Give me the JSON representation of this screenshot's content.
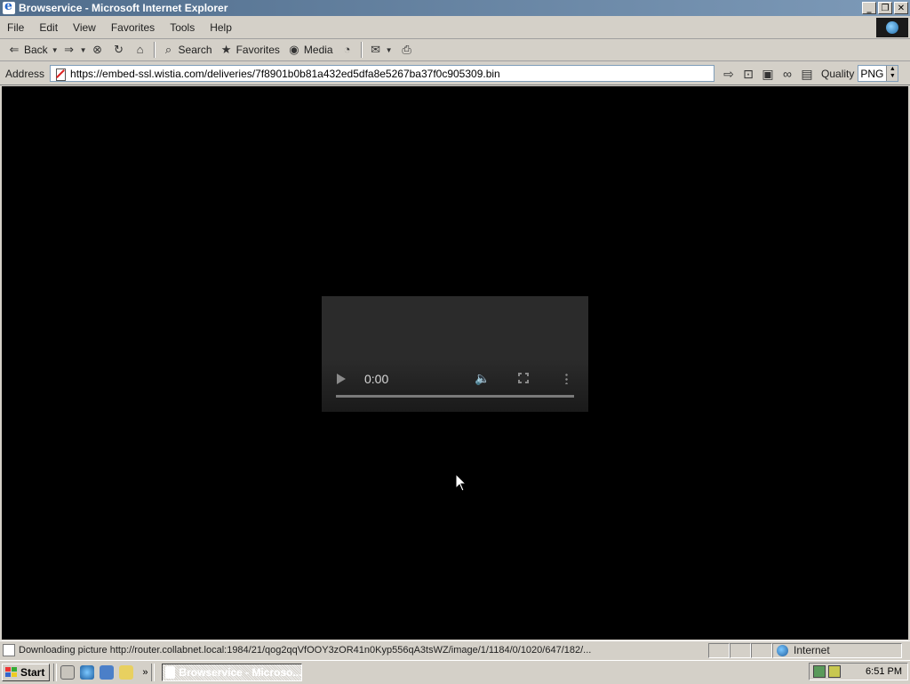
{
  "window": {
    "title": "Browservice - Microsoft Internet Explorer",
    "controls": [
      "_",
      "❐",
      "✕"
    ]
  },
  "menu": [
    "File",
    "Edit",
    "View",
    "Favorites",
    "Tools",
    "Help"
  ],
  "toolbar": {
    "back_label": "Back",
    "search_label": "Search",
    "favorites_label": "Favorites",
    "media_label": "Media"
  },
  "address": {
    "label": "Address",
    "url": "https://embed-ssl.wistia.com/deliveries/7f8901b0b81a432ed5dfa8e5267ba37f0c905309.bin",
    "quality_label": "Quality",
    "quality_value": "PNG"
  },
  "video": {
    "time": "0:00",
    "progress": 0
  },
  "status": {
    "text": "Downloading picture http://router.collabnet.local:1984/21/qog2qqVfOOY3zOR41n0Kyp556qA3tsWZ/image/1/1184/0/1020/647/182/...",
    "zone": "Internet"
  },
  "taskbar": {
    "start_label": "Start",
    "chevron": "»",
    "task_label": "Browservice - Microso...",
    "clock": "6:51 PM"
  },
  "colors": {
    "titlebar_left": "#506d8c",
    "titlebar_right": "#7d9ab8",
    "chrome": "#d4d0c8",
    "content_bg": "#000000",
    "video_bg": "#2b2b2b"
  }
}
